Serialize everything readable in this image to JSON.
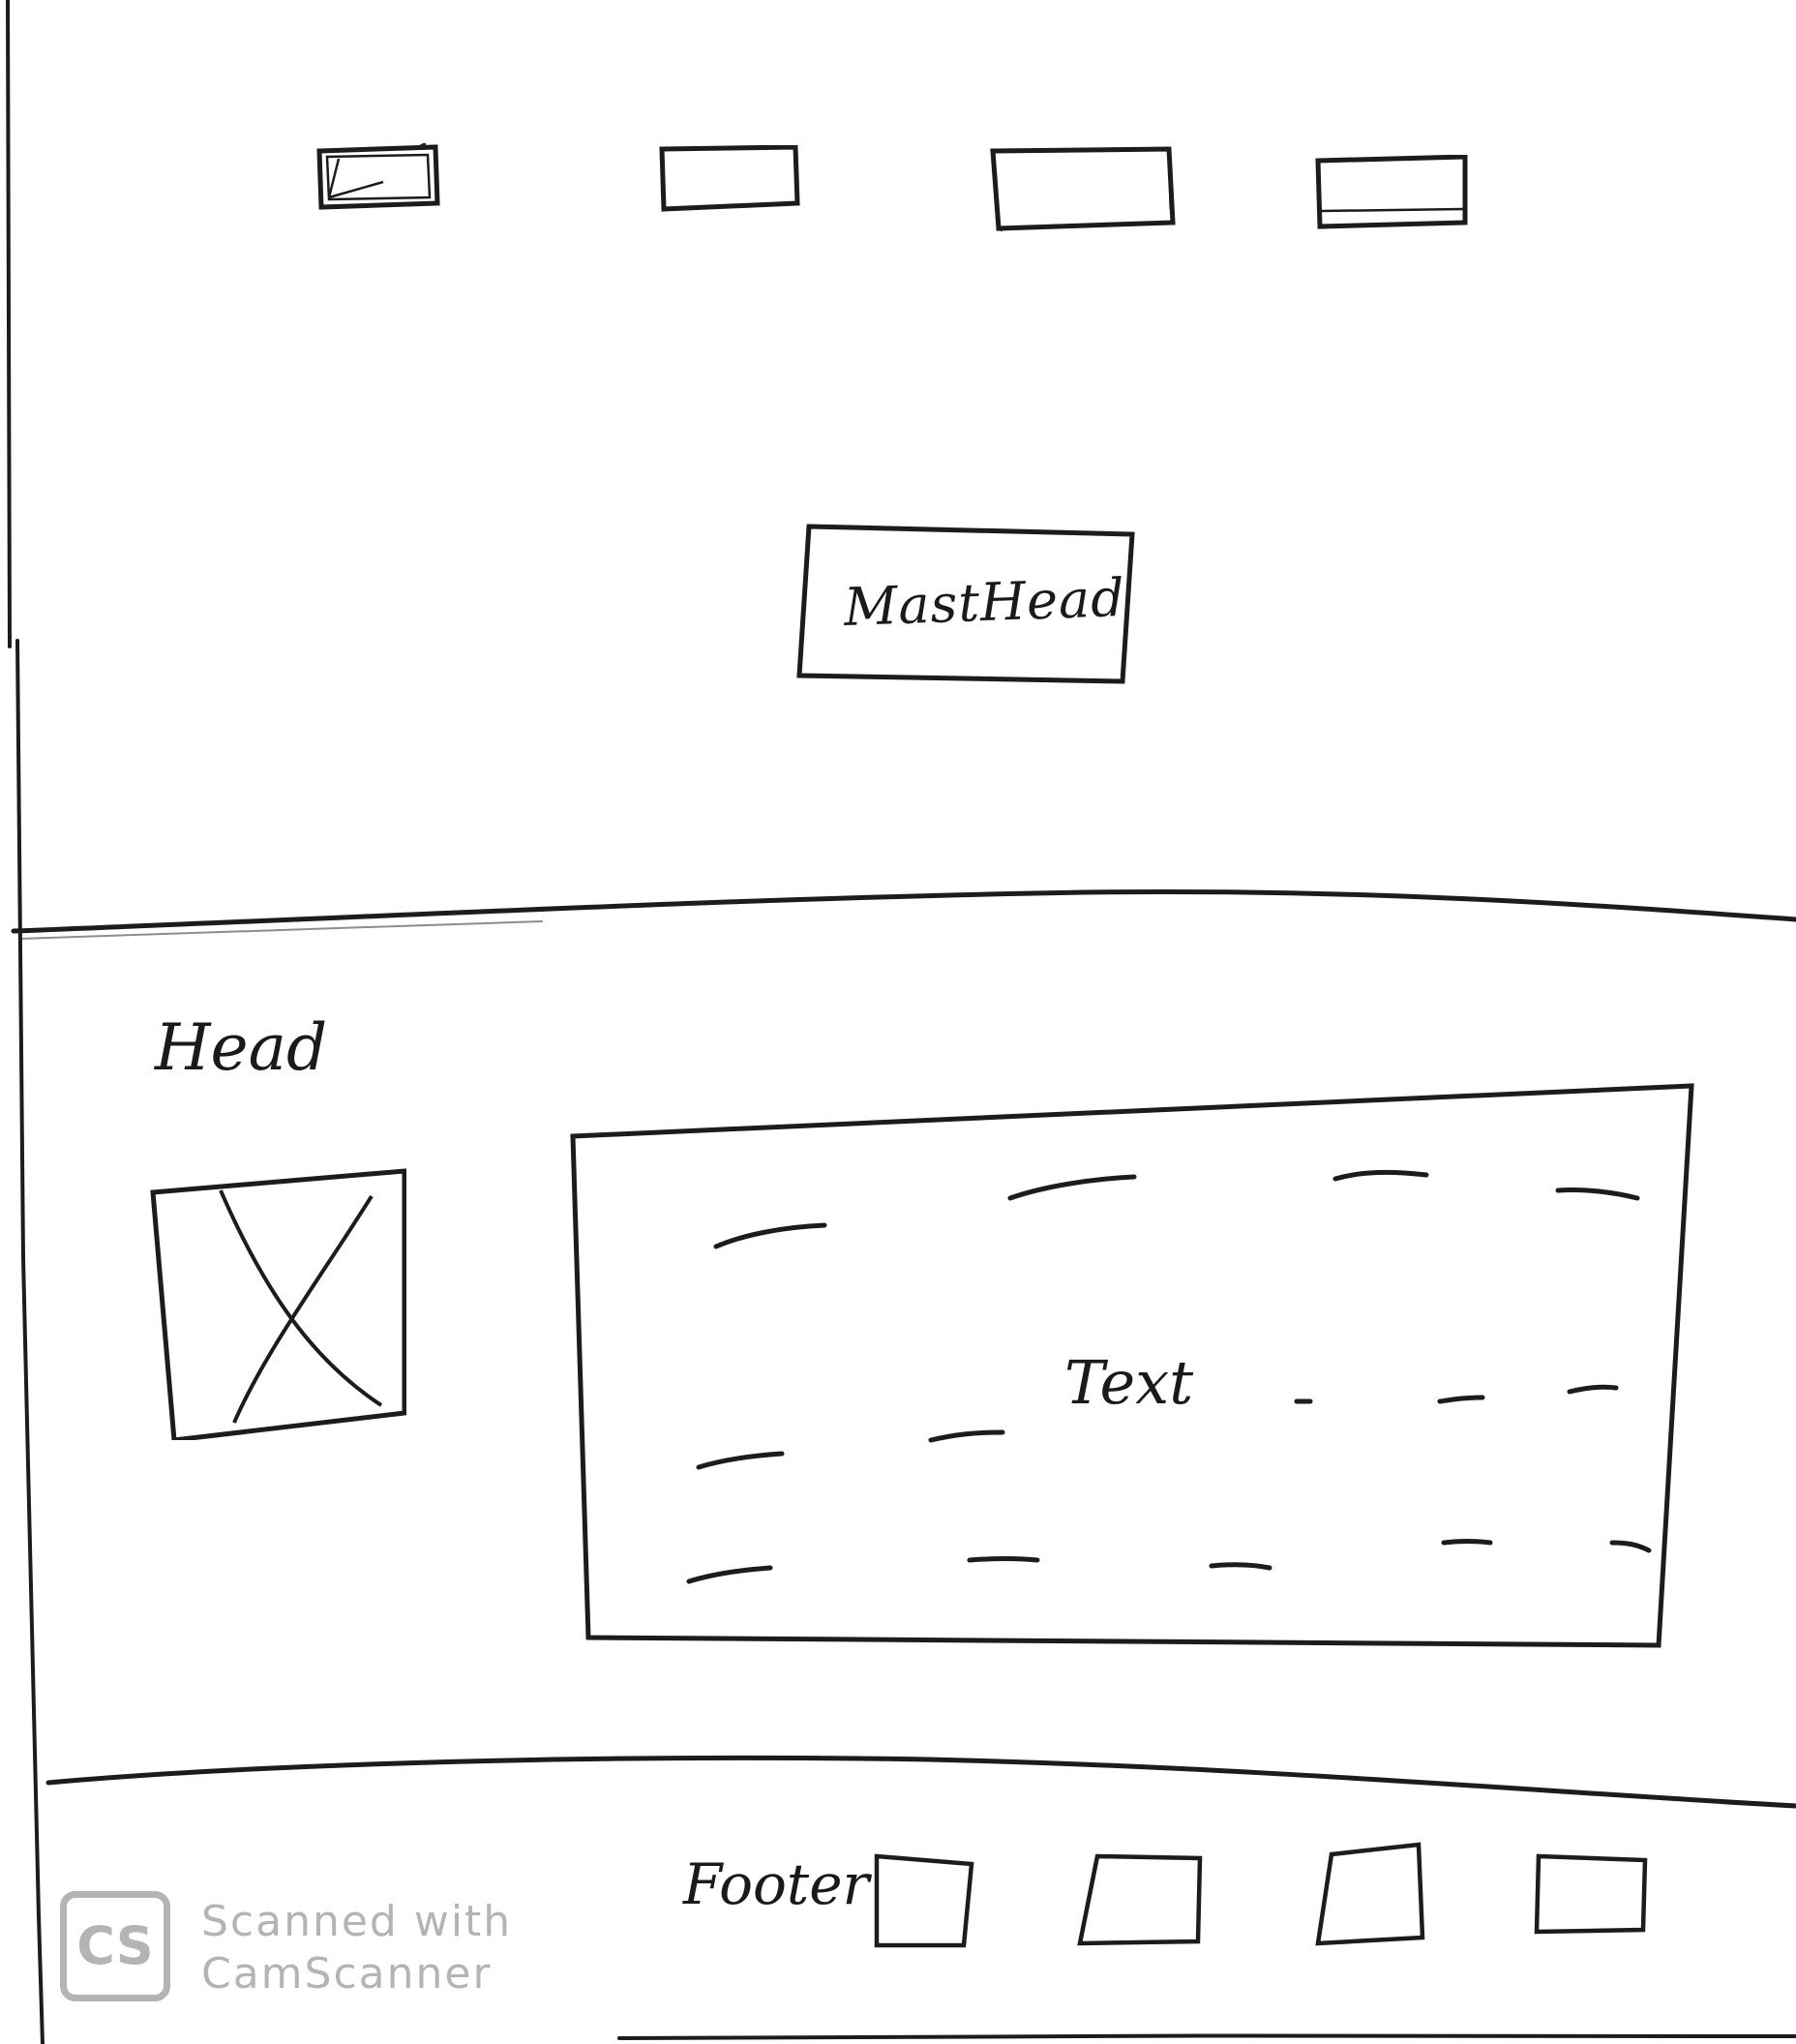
{
  "header": {
    "nav_buttons": [
      {
        "name": "nav-button-1",
        "label": ""
      },
      {
        "name": "nav-button-2",
        "label": ""
      },
      {
        "name": "nav-button-3",
        "label": ""
      },
      {
        "name": "nav-button-4",
        "label": ""
      }
    ],
    "masthead_label": "MastHead"
  },
  "main": {
    "head_label": "Head",
    "image_placeholder_icon": "image-placeholder-x-icon",
    "text_label": "Text"
  },
  "footer": {
    "label": "Footer",
    "boxes": 4
  },
  "watermark": {
    "logo_text": "CS",
    "line1": "Scanned with",
    "line2": "CamScanner"
  }
}
